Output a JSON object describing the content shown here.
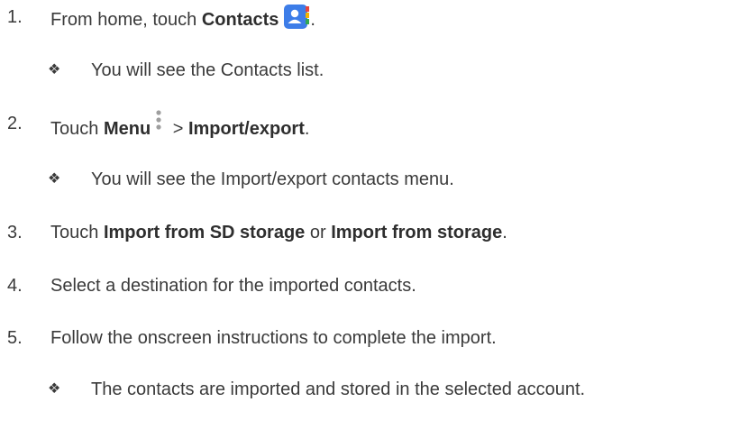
{
  "steps": [
    {
      "num": "1.",
      "text_before": "From home, touch ",
      "bold_1": "Contacts",
      "text_after": ".",
      "icon": "contacts-app-icon"
    },
    {
      "bullet": "You will see the Contacts list."
    },
    {
      "num": "2.",
      "text_before": "Touch ",
      "bold_1": "Menu",
      "icon": "menu-overflow-icon",
      "text_mid": " > ",
      "bold_2": "Import/export",
      "text_after": "."
    },
    {
      "bullet": "You will see the Import/export contacts menu."
    },
    {
      "num": "3.",
      "text_before": "Touch ",
      "bold_1": "Import from SD storage",
      "text_mid": " or ",
      "bold_2": "Import from storage",
      "text_after": "."
    },
    {
      "num": "4.",
      "text": "Select a destination for the imported contacts."
    },
    {
      "num": "5.",
      "text": "Follow the onscreen instructions to complete the import."
    },
    {
      "bullet": "The contacts are imported and stored in the selected account."
    }
  ],
  "bullet_glyph": "❖",
  "colors": {
    "text": "#3a3a3a",
    "contacts_icon_blue": "#3d7de8",
    "contacts_icon_accent_red": "#e8453c",
    "contacts_icon_accent_yellow": "#f4b400",
    "contacts_icon_accent_green": "#34a853",
    "menu_dots": "#9e9e9e"
  }
}
